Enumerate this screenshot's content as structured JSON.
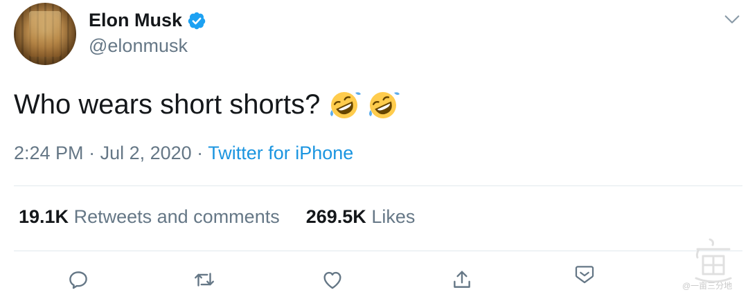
{
  "author": {
    "display_name": "Elon Musk",
    "handle": "@elonmusk",
    "verified_icon": "verified-badge-icon",
    "avatar": "profile-avatar"
  },
  "tweet": {
    "text": "Who wears short shorts?",
    "emojis": [
      "rolling-on-floor-laughing-emoji",
      "rolling-on-floor-laughing-emoji"
    ]
  },
  "meta": {
    "time": "2:24 PM",
    "separator": " · ",
    "date": "Jul 2, 2020",
    "source": "Twitter for iPhone"
  },
  "stats": {
    "retweets_count": "19.1K",
    "retweets_label": "Retweets and comments",
    "likes_count": "269.5K",
    "likes_label": "Likes"
  },
  "actions": [
    "reply-icon",
    "retweet-icon",
    "like-icon",
    "share-icon",
    "more-dropdown-icon"
  ],
  "watermark": {
    "text": "@一亩三分地"
  },
  "colors": {
    "text_primary": "#14171a",
    "text_secondary": "#657786",
    "link": "#1b95e0",
    "verified": "#1da1f2",
    "divider": "#e1e8ed"
  }
}
